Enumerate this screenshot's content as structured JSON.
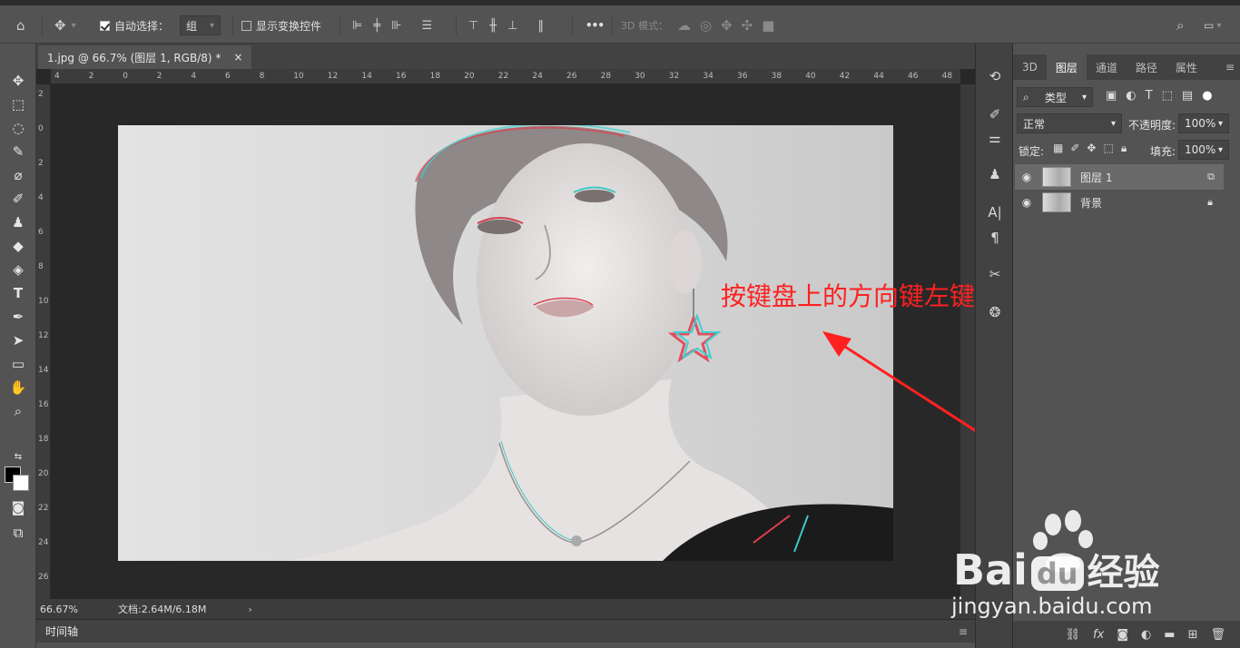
{
  "options_bar": {
    "auto_select_label": "自动选择：",
    "auto_select_value": "组",
    "show_transform_label": "显示变换控件",
    "more_label": "•••",
    "mode_3d_label": "3D 模式："
  },
  "document": {
    "tab_title": "1.jpg @ 66.7% (图层 1, RGB/8) *",
    "tab_close": "×",
    "ruler_h": [
      "4",
      "2",
      "0",
      "2",
      "4",
      "6",
      "8",
      "10",
      "12",
      "14",
      "16",
      "18",
      "20",
      "22",
      "24",
      "26",
      "28",
      "30",
      "32",
      "34",
      "36",
      "38",
      "40",
      "42",
      "44",
      "46",
      "48"
    ],
    "ruler_v": [
      "2",
      "0",
      "2",
      "4",
      "6",
      "8",
      "10",
      "12",
      "14",
      "16",
      "18",
      "20",
      "22",
      "24",
      "26"
    ],
    "zoom": "66.67%",
    "doc_info": "文档:2.64M/6.18M",
    "status_arrow": "›"
  },
  "timeline": {
    "label": "时间轴"
  },
  "panel": {
    "tabs": [
      "3D",
      "图层",
      "通道",
      "路径",
      "属性"
    ],
    "active_tab": "图层",
    "filter_kind": "类型",
    "blend_mode": "正常",
    "opacity_label": "不透明度:",
    "opacity_value": "100%",
    "lock_label": "锁定:",
    "fill_label": "填充:",
    "fill_value": "100%",
    "layers": [
      {
        "name": "图层 1",
        "selected": true
      },
      {
        "name": "背景",
        "selected": false,
        "locked": true
      }
    ]
  },
  "annotation": {
    "text": "按键盘上的方向键左键调整位置",
    "color": "#ff2020"
  },
  "watermark": {
    "brand": "Bai",
    "brand_du": "du",
    "brand_cn": "经验",
    "url": "jingyan.baidu.com"
  },
  "colors": {
    "ui_bg": "#535353",
    "canvas_bg": "#282828",
    "accent_red": "#ff2020"
  }
}
